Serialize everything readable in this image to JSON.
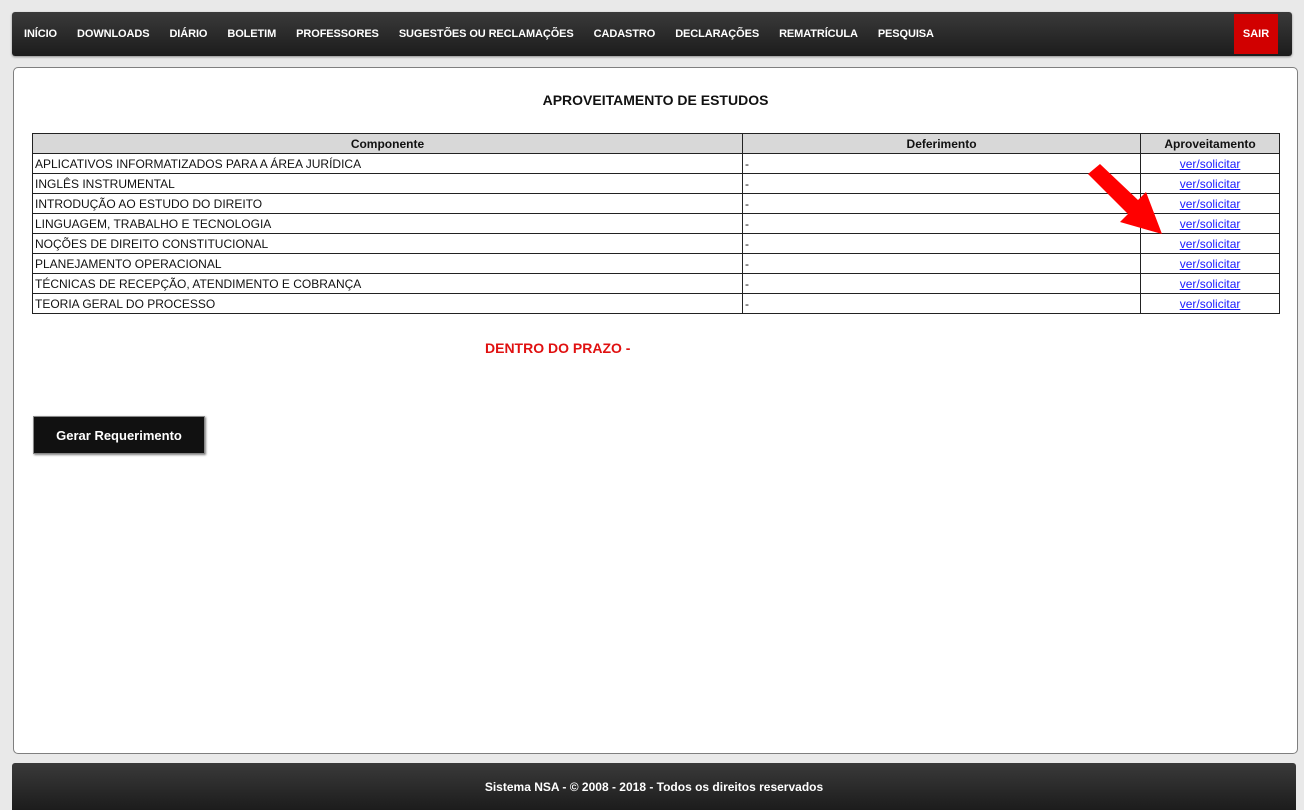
{
  "nav": {
    "items": [
      {
        "label": "INÍCIO"
      },
      {
        "label": "DOWNLOADS"
      },
      {
        "label": "DIÁRIO"
      },
      {
        "label": "BOLETIM"
      },
      {
        "label": "PROFESSORES"
      },
      {
        "label": "SUGESTÕES OU RECLAMAÇÕES"
      },
      {
        "label": "CADASTRO"
      },
      {
        "label": "DECLARAÇÕES"
      },
      {
        "label": "REMATRÍCULA"
      },
      {
        "label": "PESQUISA"
      }
    ],
    "logout_label": "SAIR"
  },
  "main": {
    "title": "APROVEITAMENTO DE ESTUDOS",
    "table": {
      "headers": [
        "Componente",
        "Deferimento",
        "Aproveitamento"
      ],
      "rows": [
        {
          "componente": "APLICATIVOS INFORMATIZADOS PARA A ÁREA JURÍDICA",
          "deferimento": "-",
          "link": "ver/solicitar"
        },
        {
          "componente": "INGLÊS INSTRUMENTAL",
          "deferimento": "-",
          "link": "ver/solicitar"
        },
        {
          "componente": "INTRODUÇÃO AO ESTUDO DO DIREITO",
          "deferimento": "-",
          "link": "ver/solicitar"
        },
        {
          "componente": "LINGUAGEM, TRABALHO E TECNOLOGIA",
          "deferimento": "-",
          "link": "ver/solicitar"
        },
        {
          "componente": "NOÇÕES DE DIREITO CONSTITUCIONAL",
          "deferimento": "-",
          "link": "ver/solicitar"
        },
        {
          "componente": "PLANEJAMENTO OPERACIONAL",
          "deferimento": "-",
          "link": "ver/solicitar"
        },
        {
          "componente": "TÉCNICAS DE RECEPÇÃO, ATENDIMENTO E COBRANÇA",
          "deferimento": "-",
          "link": "ver/solicitar"
        },
        {
          "componente": "TEORIA GERAL DO PROCESSO",
          "deferimento": "-",
          "link": "ver/solicitar"
        }
      ]
    },
    "status": "DENTRO DO PRAZO -",
    "button_label": "Gerar Requerimento"
  },
  "annotation": {
    "icon": "red-arrow-icon",
    "color": "#ff0000"
  },
  "footer": {
    "text": "Sistema NSA  -  © 2008 - 2018  -  Todos os direitos reservados"
  },
  "colors": {
    "nav_bg": "#2a2a2a",
    "logout_bg": "#d10000",
    "status_red": "#e01010",
    "link_blue": "#1a1aff",
    "header_gray": "#d8d8d8"
  }
}
